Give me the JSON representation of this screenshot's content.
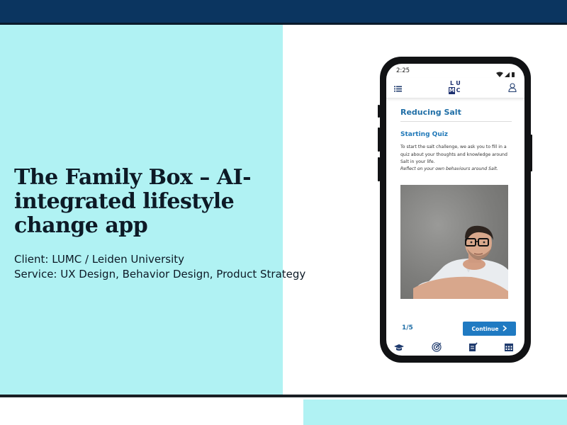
{
  "slide": {
    "title": "The Family Box – AI-integrated lifestyle change app",
    "client": "Client: LUMC / Leiden University",
    "service": "Service: UX Design, Behavior Design, Product Strategy"
  },
  "phone": {
    "status_time": "2:25",
    "logo_letters": [
      "L",
      "U",
      "M",
      "C"
    ],
    "screen_title": "Reducing Salt",
    "section_title": "Starting Quiz",
    "intro_text": "To start the salt challenge, we ask you to fill in a quiz about your thoughts and knowledge around Salt in your life.",
    "reflect_text": "Reflect on your own behaviours around Salt.",
    "progress": "1/5",
    "continue_label": "Continue",
    "nav_items": [
      "learn-icon",
      "target-icon",
      "notes-icon",
      "calendar-icon"
    ]
  },
  "colors": {
    "top_bar": "#0b3560",
    "accent_cyan": "#b0f2f3",
    "app_blue": "#1f7ac2",
    "logo_navy": "#1c2f6f"
  }
}
